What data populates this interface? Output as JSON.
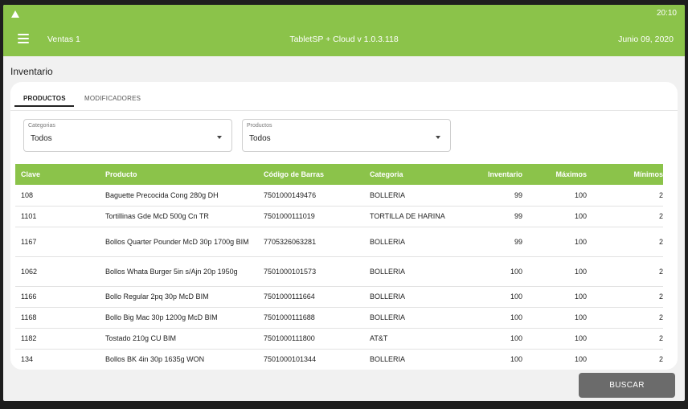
{
  "status_bar": {
    "time": "20:10",
    "icon": "warning-triangle-icon"
  },
  "app_bar": {
    "menu_icon": "hamburger-menu-icon",
    "left_title": "Ventas 1",
    "center_title": "TabletSP + Cloud v 1.0.3.118",
    "date": "Junio 09, 2020"
  },
  "page": {
    "title": "Inventario"
  },
  "tabs": [
    {
      "label": "PRODUCTOS",
      "active": true
    },
    {
      "label": "MODIFICADORES",
      "active": false
    }
  ],
  "filters": {
    "categories": {
      "label": "Categorias",
      "value": "Todos"
    },
    "products": {
      "label": "Productos",
      "value": "Todos"
    }
  },
  "table": {
    "headers": [
      "Clave",
      "Producto",
      "Código de Barras",
      "Categoria",
      "Inventario",
      "Máximos",
      "Mínimos"
    ],
    "rows": [
      [
        "108",
        "Baguette Precocida Cong 280g DH",
        "7501000149476",
        "BOLLERIA",
        "99",
        "100",
        "2"
      ],
      [
        "1101",
        "Tortillinas Gde McD 500g Cn TR",
        "7501000111019",
        "TORTILLA DE HARINA",
        "99",
        "100",
        "2"
      ],
      [
        "1167",
        "Bollos Quarter Pounder McD 30p 1700g BIM",
        "7705326063281",
        "BOLLERIA",
        "99",
        "100",
        "2"
      ],
      [
        "1062",
        "Bollos Whata Burger 5in s/Ajn 20p 1950g",
        "7501000101573",
        "BOLLERIA",
        "100",
        "100",
        "2"
      ],
      [
        "1166",
        "Bollo Regular 2pq 30p McD BIM",
        "7501000111664",
        "BOLLERIA",
        "100",
        "100",
        "2"
      ],
      [
        "1168",
        "Bollo Big Mac 30p 1200g McD BIM",
        "7501000111688",
        "BOLLERIA",
        "100",
        "100",
        "2"
      ],
      [
        "1182",
        "Tostado 210g CU BIM",
        "7501000111800",
        "AT&T",
        "100",
        "100",
        "2"
      ],
      [
        "134",
        "Bollos BK 4in 30p 1635g WON",
        "7501000101344",
        "BOLLERIA",
        "100",
        "100",
        "2"
      ]
    ]
  },
  "actions": {
    "search_label": "BUSCAR"
  },
  "colors": {
    "primary": "#8bc34a",
    "button": "#6b6b6b",
    "background": "#f1f1f1"
  }
}
